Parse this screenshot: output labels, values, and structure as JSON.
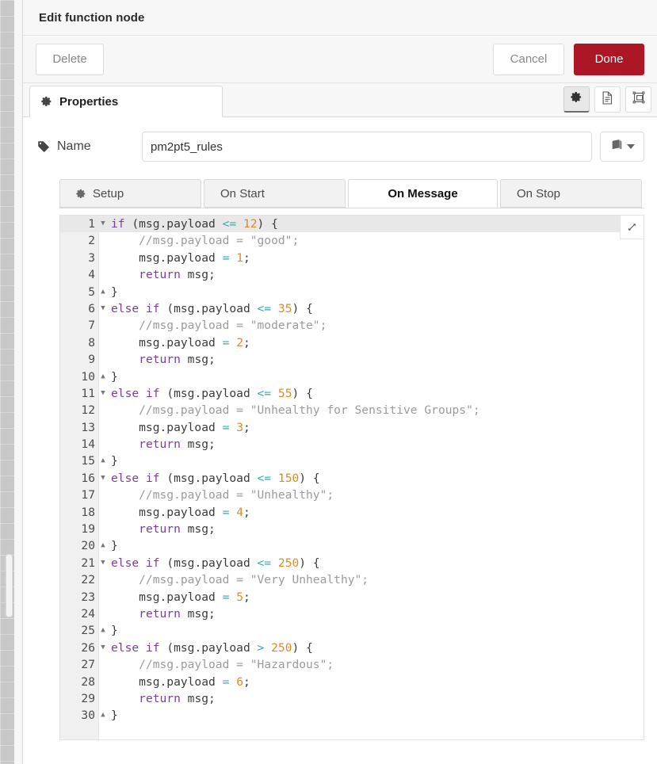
{
  "dialog": {
    "title": "Edit function node"
  },
  "toolbar": {
    "delete_label": "Delete",
    "cancel_label": "Cancel",
    "done_label": "Done",
    "done_color": "#ad1625"
  },
  "tabs": {
    "properties_label": "Properties",
    "icons": [
      {
        "name": "gear-icon",
        "active": true
      },
      {
        "name": "description-icon",
        "active": false
      },
      {
        "name": "appearance-icon",
        "active": false
      }
    ]
  },
  "name_row": {
    "label": "Name",
    "value": "pm2pt5_rules",
    "placeholder": "Name",
    "library_icon": "book-icon"
  },
  "code_tabs": [
    {
      "label": "Setup",
      "icon": "gear-icon",
      "active": false
    },
    {
      "label": "On Start",
      "icon": "",
      "active": false
    },
    {
      "label": "On Message",
      "icon": "",
      "active": true
    },
    {
      "label": "On Stop",
      "icon": "",
      "active": false
    }
  ],
  "editor": {
    "active_line": 1,
    "expand_icon": "expand-icon",
    "total_lines": 30,
    "lines": [
      {
        "n": 1,
        "fold": "down",
        "tokens": [
          {
            "t": "kw",
            "v": "if"
          },
          {
            "t": "pln",
            "v": " (msg.payload "
          },
          {
            "t": "op",
            "v": "<="
          },
          {
            "t": "pln",
            "v": " "
          },
          {
            "t": "num",
            "v": "12"
          },
          {
            "t": "pln",
            "v": ") {"
          }
        ]
      },
      {
        "n": 2,
        "fold": "",
        "tokens": [
          {
            "t": "cmt",
            "v": "    //msg.payload = \"good\";"
          }
        ]
      },
      {
        "n": 3,
        "fold": "",
        "tokens": [
          {
            "t": "pln",
            "v": "    msg.payload "
          },
          {
            "t": "op",
            "v": "="
          },
          {
            "t": "pln",
            "v": " "
          },
          {
            "t": "num",
            "v": "1"
          },
          {
            "t": "pln",
            "v": ";"
          }
        ]
      },
      {
        "n": 4,
        "fold": "",
        "tokens": [
          {
            "t": "pln",
            "v": "    "
          },
          {
            "t": "kw",
            "v": "return"
          },
          {
            "t": "pln",
            "v": " msg;"
          }
        ]
      },
      {
        "n": 5,
        "fold": "up",
        "tokens": [
          {
            "t": "pln",
            "v": "}"
          }
        ]
      },
      {
        "n": 6,
        "fold": "down",
        "tokens": [
          {
            "t": "kw",
            "v": "else"
          },
          {
            "t": "pln",
            "v": " "
          },
          {
            "t": "kw",
            "v": "if"
          },
          {
            "t": "pln",
            "v": " (msg.payload "
          },
          {
            "t": "op",
            "v": "<="
          },
          {
            "t": "pln",
            "v": " "
          },
          {
            "t": "num",
            "v": "35"
          },
          {
            "t": "pln",
            "v": ") {"
          }
        ]
      },
      {
        "n": 7,
        "fold": "",
        "tokens": [
          {
            "t": "cmt",
            "v": "    //msg.payload = \"moderate\";"
          }
        ]
      },
      {
        "n": 8,
        "fold": "",
        "tokens": [
          {
            "t": "pln",
            "v": "    msg.payload "
          },
          {
            "t": "op",
            "v": "="
          },
          {
            "t": "pln",
            "v": " "
          },
          {
            "t": "num",
            "v": "2"
          },
          {
            "t": "pln",
            "v": ";"
          }
        ]
      },
      {
        "n": 9,
        "fold": "",
        "tokens": [
          {
            "t": "pln",
            "v": "    "
          },
          {
            "t": "kw",
            "v": "return"
          },
          {
            "t": "pln",
            "v": " msg;"
          }
        ]
      },
      {
        "n": 10,
        "fold": "up",
        "tokens": [
          {
            "t": "pln",
            "v": "}"
          }
        ]
      },
      {
        "n": 11,
        "fold": "down",
        "tokens": [
          {
            "t": "kw",
            "v": "else"
          },
          {
            "t": "pln",
            "v": " "
          },
          {
            "t": "kw",
            "v": "if"
          },
          {
            "t": "pln",
            "v": " (msg.payload "
          },
          {
            "t": "op",
            "v": "<="
          },
          {
            "t": "pln",
            "v": " "
          },
          {
            "t": "num",
            "v": "55"
          },
          {
            "t": "pln",
            "v": ") {"
          }
        ]
      },
      {
        "n": 12,
        "fold": "",
        "tokens": [
          {
            "t": "cmt",
            "v": "    //msg.payload = \"Unhealthy for Sensitive Groups\";"
          }
        ]
      },
      {
        "n": 13,
        "fold": "",
        "tokens": [
          {
            "t": "pln",
            "v": "    msg.payload "
          },
          {
            "t": "op",
            "v": "="
          },
          {
            "t": "pln",
            "v": " "
          },
          {
            "t": "num",
            "v": "3"
          },
          {
            "t": "pln",
            "v": ";"
          }
        ]
      },
      {
        "n": 14,
        "fold": "",
        "tokens": [
          {
            "t": "pln",
            "v": "    "
          },
          {
            "t": "kw",
            "v": "return"
          },
          {
            "t": "pln",
            "v": " msg;"
          }
        ]
      },
      {
        "n": 15,
        "fold": "up",
        "tokens": [
          {
            "t": "pln",
            "v": "}"
          }
        ]
      },
      {
        "n": 16,
        "fold": "down",
        "tokens": [
          {
            "t": "kw",
            "v": "else"
          },
          {
            "t": "pln",
            "v": " "
          },
          {
            "t": "kw",
            "v": "if"
          },
          {
            "t": "pln",
            "v": " (msg.payload "
          },
          {
            "t": "op",
            "v": "<="
          },
          {
            "t": "pln",
            "v": " "
          },
          {
            "t": "num",
            "v": "150"
          },
          {
            "t": "pln",
            "v": ") {"
          }
        ]
      },
      {
        "n": 17,
        "fold": "",
        "tokens": [
          {
            "t": "cmt",
            "v": "    //msg.payload = \"Unhealthy\";"
          }
        ]
      },
      {
        "n": 18,
        "fold": "",
        "tokens": [
          {
            "t": "pln",
            "v": "    msg.payload "
          },
          {
            "t": "op",
            "v": "="
          },
          {
            "t": "pln",
            "v": " "
          },
          {
            "t": "num",
            "v": "4"
          },
          {
            "t": "pln",
            "v": ";"
          }
        ]
      },
      {
        "n": 19,
        "fold": "",
        "tokens": [
          {
            "t": "pln",
            "v": "    "
          },
          {
            "t": "kw",
            "v": "return"
          },
          {
            "t": "pln",
            "v": " msg;"
          }
        ]
      },
      {
        "n": 20,
        "fold": "up",
        "tokens": [
          {
            "t": "pln",
            "v": "}"
          }
        ]
      },
      {
        "n": 21,
        "fold": "down",
        "tokens": [
          {
            "t": "kw",
            "v": "else"
          },
          {
            "t": "pln",
            "v": " "
          },
          {
            "t": "kw",
            "v": "if"
          },
          {
            "t": "pln",
            "v": " (msg.payload "
          },
          {
            "t": "op",
            "v": "<="
          },
          {
            "t": "pln",
            "v": " "
          },
          {
            "t": "num",
            "v": "250"
          },
          {
            "t": "pln",
            "v": ") {"
          }
        ]
      },
      {
        "n": 22,
        "fold": "",
        "tokens": [
          {
            "t": "cmt",
            "v": "    //msg.payload = \"Very Unhealthy\";"
          }
        ]
      },
      {
        "n": 23,
        "fold": "",
        "tokens": [
          {
            "t": "pln",
            "v": "    msg.payload "
          },
          {
            "t": "op",
            "v": "="
          },
          {
            "t": "pln",
            "v": " "
          },
          {
            "t": "num",
            "v": "5"
          },
          {
            "t": "pln",
            "v": ";"
          }
        ]
      },
      {
        "n": 24,
        "fold": "",
        "tokens": [
          {
            "t": "pln",
            "v": "    "
          },
          {
            "t": "kw",
            "v": "return"
          },
          {
            "t": "pln",
            "v": " msg;"
          }
        ]
      },
      {
        "n": 25,
        "fold": "up",
        "tokens": [
          {
            "t": "pln",
            "v": "}"
          }
        ]
      },
      {
        "n": 26,
        "fold": "down",
        "tokens": [
          {
            "t": "kw",
            "v": "else"
          },
          {
            "t": "pln",
            "v": " "
          },
          {
            "t": "kw",
            "v": "if"
          },
          {
            "t": "pln",
            "v": " (msg.payload "
          },
          {
            "t": "op",
            "v": ">"
          },
          {
            "t": "pln",
            "v": " "
          },
          {
            "t": "num",
            "v": "250"
          },
          {
            "t": "pln",
            "v": ") {"
          }
        ]
      },
      {
        "n": 27,
        "fold": "",
        "tokens": [
          {
            "t": "cmt",
            "v": "    //msg.payload = \"Hazardous\";"
          }
        ]
      },
      {
        "n": 28,
        "fold": "",
        "tokens": [
          {
            "t": "pln",
            "v": "    msg.payload "
          },
          {
            "t": "op",
            "v": "="
          },
          {
            "t": "pln",
            "v": " "
          },
          {
            "t": "num",
            "v": "6"
          },
          {
            "t": "pln",
            "v": ";"
          }
        ]
      },
      {
        "n": 29,
        "fold": "",
        "tokens": [
          {
            "t": "pln",
            "v": "    "
          },
          {
            "t": "kw",
            "v": "return"
          },
          {
            "t": "pln",
            "v": " msg;"
          }
        ]
      },
      {
        "n": 30,
        "fold": "up",
        "tokens": [
          {
            "t": "pln",
            "v": "}"
          }
        ]
      }
    ]
  }
}
